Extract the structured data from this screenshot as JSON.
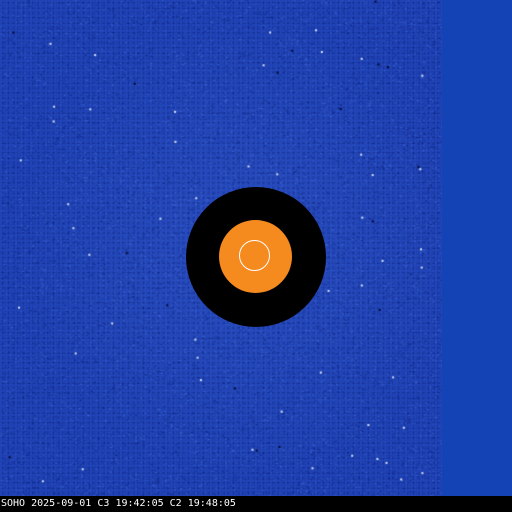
{
  "image": {
    "observatory": "SOHO",
    "date": "2025-09-01",
    "c3_label": "C3",
    "c3_time": "19:42:05",
    "c2_label": "C2",
    "c2_time": "19:48:05"
  },
  "colors": {
    "background_field": "#1d3fb0",
    "edge_panel": "#1343b5",
    "occulter_outer": "#000000",
    "occulter_inner": "#f58a1f",
    "sun_outline": "#ffffff",
    "label_text": "#ffffff",
    "label_background": "#000000"
  }
}
